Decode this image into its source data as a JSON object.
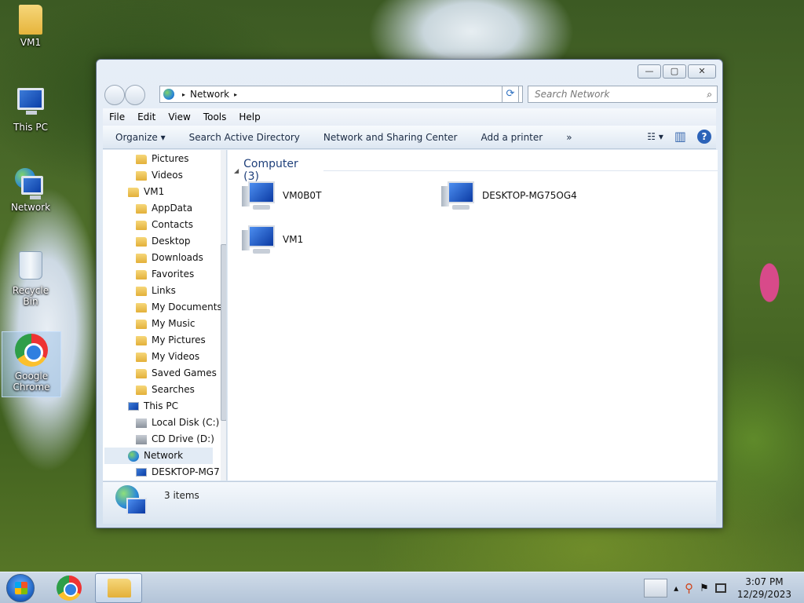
{
  "desktop": {
    "icons": [
      {
        "label": "VM1"
      },
      {
        "label": "This PC"
      },
      {
        "label": "Network"
      },
      {
        "label": "Recycle Bin"
      },
      {
        "label": "Google Chrome"
      }
    ]
  },
  "window": {
    "controls": {
      "minimize": "—",
      "maximize": "▢",
      "close": "✕"
    },
    "address": {
      "path": "Network",
      "arrow": "▸",
      "refresh": "⟳"
    },
    "search": {
      "placeholder": "Search Network",
      "icon": "⌕"
    },
    "menu": [
      "File",
      "Edit",
      "View",
      "Tools",
      "Help"
    ],
    "commands": {
      "organize": "Organize ▾",
      "search_ad": "Search Active Directory",
      "sharing_center": "Network and Sharing Center",
      "add_printer": "Add a printer",
      "more": "»",
      "views": "☷ ▾",
      "preview": "▥",
      "help": "?"
    },
    "nav": [
      "Pictures",
      "Videos",
      "VM1",
      "AppData",
      "Contacts",
      "Desktop",
      "Downloads",
      "Favorites",
      "Links",
      "My Documents",
      "My Music",
      "My Pictures",
      "My Videos",
      "Saved Games",
      "Searches",
      "This PC",
      "Local Disk (C:)",
      "CD Drive (D:)",
      "Network",
      "DESKTOP-MG7"
    ],
    "group": {
      "label": "Computer (3)",
      "arrow": "◢"
    },
    "computers": [
      "VM0B0T",
      "DESKTOP-MG75OG4",
      "VM1"
    ],
    "status": "3 items"
  },
  "taskbar": {
    "tray_arrow": "▴",
    "time": "3:07 PM",
    "date": "12/29/2023"
  }
}
